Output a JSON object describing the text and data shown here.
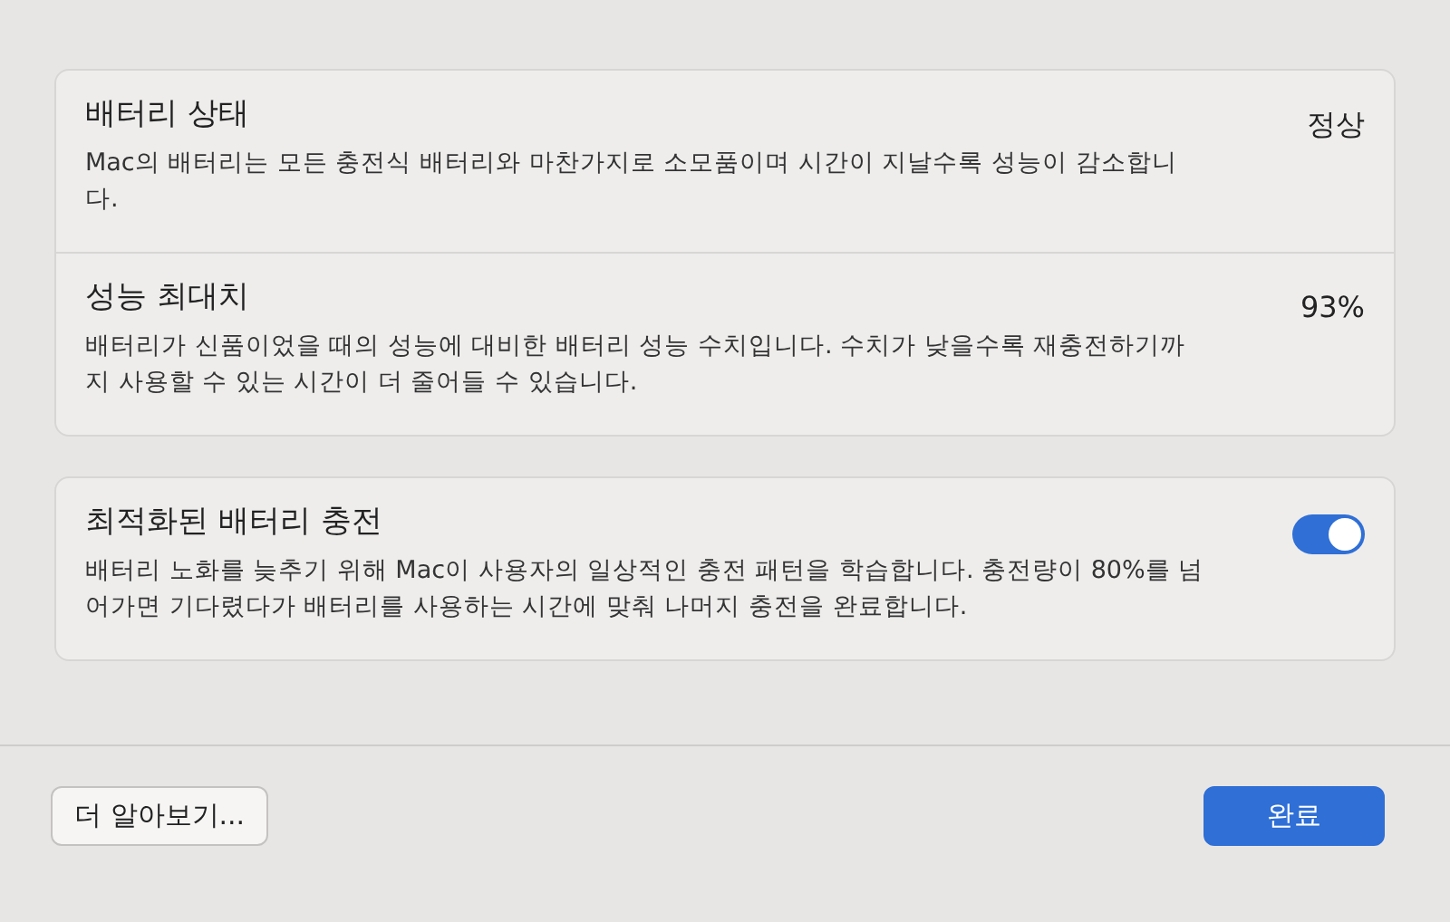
{
  "groups": [
    {
      "items": [
        {
          "kind": "value",
          "title": "배터리 상태",
          "description": "Mac의 배터리는 모든 충전식 배터리와 마찬가지로 소모품이며 시간이 지날수록 성능이 감소합니다.",
          "value": "정상"
        },
        {
          "kind": "value",
          "title": "성능 최대치",
          "description": "배터리가 신품이었을 때의 성능에 대비한 배터리 성능 수치입니다. 수치가 낮을수록 재충전하기까지 사용할 수 있는 시간이 더 줄어들 수 있습니다.",
          "value": "93%"
        }
      ]
    },
    {
      "items": [
        {
          "kind": "toggle",
          "title": "최적화된 배터리 충전",
          "description": "배터리 노화를 늦추기 위해 Mac이 사용자의 일상적인 충전 패턴을 학습합니다. 충전량이 80%를 넘어가면 기다렸다가 배터리를 사용하는 시간에 맞춰 나머지 충전을 완료합니다.",
          "on": true
        }
      ]
    }
  ],
  "buttons": {
    "learn_more": "더 알아보기...",
    "done": "완료"
  }
}
